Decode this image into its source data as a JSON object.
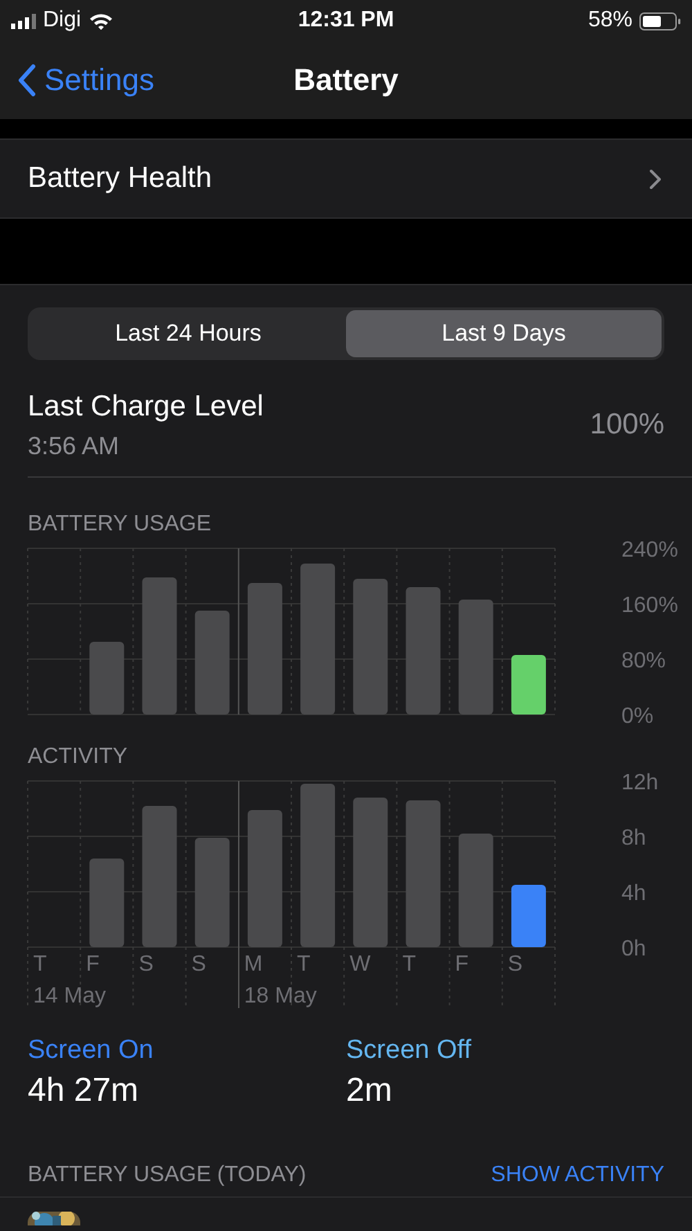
{
  "status_bar": {
    "carrier": "Digi",
    "time": "12:31 PM",
    "battery": "58%"
  },
  "nav": {
    "back": "Settings",
    "title": "Battery"
  },
  "health_row": {
    "label": "Battery Health"
  },
  "segments": [
    {
      "label": "Last 24 Hours",
      "selected": false
    },
    {
      "label": "Last 9 Days",
      "selected": true
    }
  ],
  "last_charge": {
    "title": "Last Charge Level",
    "time": "3:56 AM",
    "value": "100%"
  },
  "usage": {
    "heading": "BATTERY USAGE",
    "chart_data": {
      "type": "bar",
      "ylim": [
        0,
        240
      ],
      "yticks": [
        {
          "value": 0,
          "label": "0%"
        },
        {
          "value": 80,
          "label": "80%"
        },
        {
          "value": 160,
          "label": "160%"
        },
        {
          "value": 240,
          "label": "240%"
        }
      ],
      "series": [
        {
          "color": "#4a4a4c",
          "values": [
            null,
            105,
            198,
            150,
            190,
            218,
            196,
            184,
            166,
            null
          ]
        },
        {
          "color": "#65d06a",
          "values": [
            null,
            null,
            null,
            null,
            null,
            null,
            null,
            null,
            null,
            86
          ]
        }
      ]
    }
  },
  "activity": {
    "heading": "ACTIVITY",
    "chart_data": {
      "type": "bar",
      "ylim": [
        0,
        12
      ],
      "categories": [
        "T",
        "F",
        "S",
        "S",
        "M",
        "T",
        "W",
        "T",
        "F",
        "S"
      ],
      "yticks": [
        {
          "value": 0,
          "label": "0h"
        },
        {
          "value": 4,
          "label": "4h"
        },
        {
          "value": 8,
          "label": "8h"
        },
        {
          "value": 12,
          "label": "12h"
        }
      ],
      "series": [
        {
          "color": "#4a4a4c",
          "values": [
            null,
            6.4,
            10.2,
            7.9,
            9.9,
            11.8,
            10.8,
            10.6,
            8.2,
            null
          ]
        },
        {
          "color": "#3a82f7",
          "values": [
            null,
            null,
            null,
            null,
            null,
            null,
            null,
            null,
            null,
            4.5
          ]
        }
      ]
    },
    "week_labels": [
      "14 May",
      "18 May"
    ]
  },
  "screen_stats": [
    {
      "label": "Screen On",
      "value": "4h 27m",
      "color": "#3a82f7"
    },
    {
      "label": "Screen Off",
      "value": "2m",
      "color": "#64b6f0"
    }
  ],
  "today_section": {
    "heading": "BATTERY USAGE (TODAY)",
    "action": "SHOW ACTIVITY"
  }
}
